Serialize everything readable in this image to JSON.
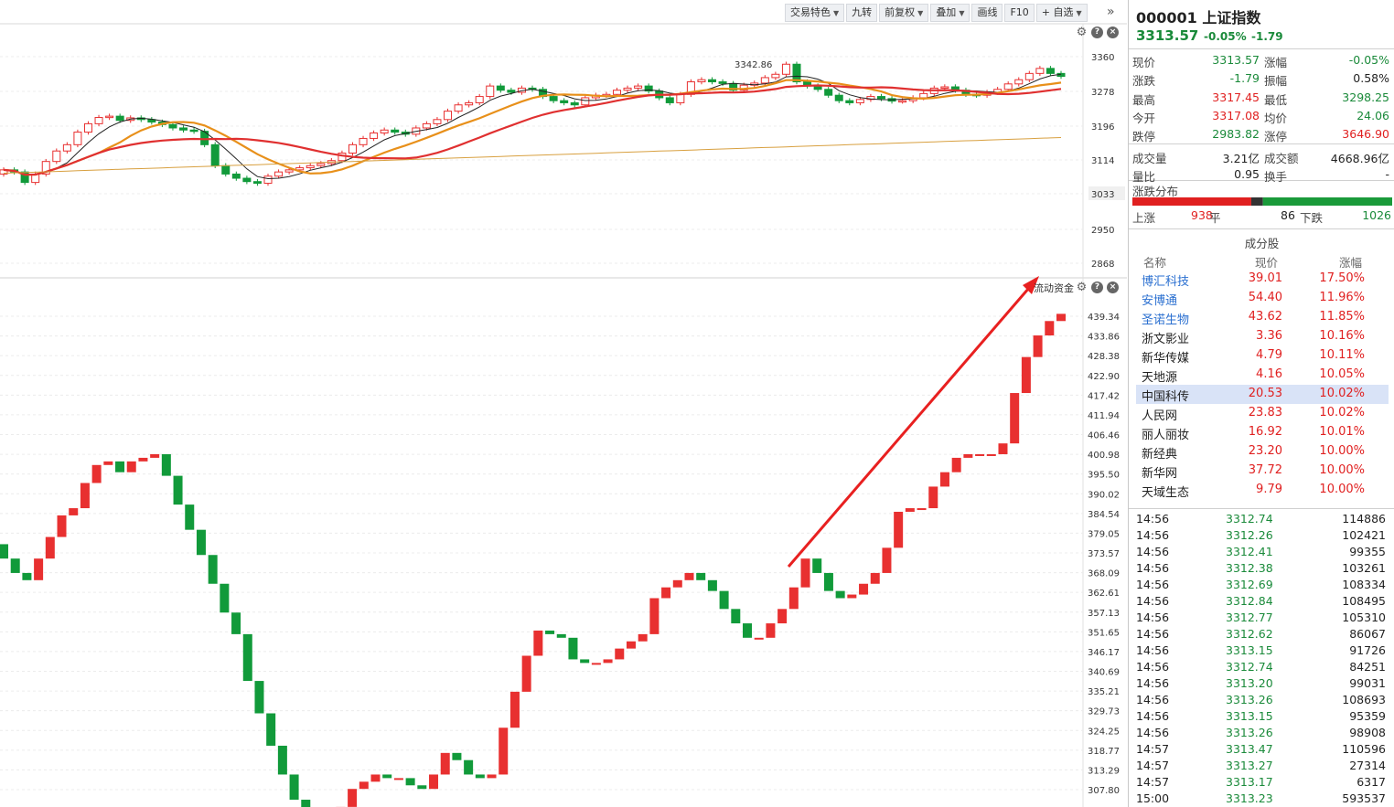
{
  "toolbar": {
    "buttons": [
      {
        "label": "交易特色",
        "dropdown": true
      },
      {
        "label": "九转",
        "dropdown": false
      },
      {
        "label": "前复权",
        "dropdown": true
      },
      {
        "label": "叠加",
        "dropdown": true
      },
      {
        "label": "画线",
        "dropdown": false
      },
      {
        "label": "F10",
        "dropdown": false
      },
      {
        "label": "+ 自选",
        "dropdown": true
      }
    ],
    "more_icon": "double-chevron-right-icon"
  },
  "kline": {
    "peak_label": "3342.86",
    "axis_labels": [
      "3360",
      "3278",
      "3196",
      "3114",
      "3033",
      "2950",
      "2868"
    ],
    "highlight_label": "3033"
  },
  "flow": {
    "label": "流动资金",
    "axis_labels": [
      "439.34",
      "433.86",
      "428.38",
      "422.90",
      "417.42",
      "411.94",
      "406.46",
      "400.98",
      "395.50",
      "390.02",
      "384.54",
      "379.05",
      "373.57",
      "368.09",
      "362.61",
      "357.13",
      "351.65",
      "346.17",
      "340.69",
      "335.21",
      "329.73",
      "324.25",
      "318.77",
      "313.29",
      "307.80"
    ]
  },
  "quote": {
    "code_name": "000001 上证指数",
    "price": "3313.57",
    "pct": "-0.05%",
    "chg": "-1.79",
    "rows": [
      {
        "k1": "现价",
        "v1": "3313.57",
        "c1": "green",
        "k2": "涨幅",
        "v2": "-0.05%",
        "c2": "green"
      },
      {
        "k1": "涨跌",
        "v1": "-1.79",
        "c1": "green",
        "k2": "振幅",
        "v2": "0.58%",
        "c2": "blk"
      },
      {
        "k1": "最高",
        "v1": "3317.45",
        "c1": "red",
        "k2": "最低",
        "v2": "3298.25",
        "c2": "green"
      },
      {
        "k1": "今开",
        "v1": "3317.08",
        "c1": "red",
        "k2": "均价",
        "v2": "24.06",
        "c2": "green"
      },
      {
        "k1": "跌停",
        "v1": "2983.82",
        "c1": "green",
        "k2": "涨停",
        "v2": "3646.90",
        "c2": "red"
      },
      {
        "k1": "成交量",
        "v1": "3.21亿",
        "c1": "blk",
        "k2": "成交额",
        "v2": "4668.96亿",
        "c2": "blk"
      },
      {
        "k1": "量比",
        "v1": "0.95",
        "c1": "blk",
        "k2": "换手",
        "v2": "-",
        "c2": "blk"
      }
    ]
  },
  "distribution": {
    "title": "涨跌分布",
    "up_label": "上涨",
    "up": "938",
    "flat_label": "平",
    "flat": "86",
    "down_label": "下跌",
    "down": "1026",
    "up_count": 938,
    "flat_count": 86,
    "down_count": 1026
  },
  "components": {
    "title": "成分股",
    "headers": {
      "name": "名称",
      "price": "现价",
      "change": "涨幅"
    },
    "rows": [
      {
        "name": "博汇科技",
        "price": "39.01",
        "change": "17.50%",
        "blue": true,
        "hl": false
      },
      {
        "name": "安博通",
        "price": "54.40",
        "change": "11.96%",
        "blue": true,
        "hl": false
      },
      {
        "name": "圣诺生物",
        "price": "43.62",
        "change": "11.85%",
        "blue": true,
        "hl": false
      },
      {
        "name": "浙文影业",
        "price": "3.36",
        "change": "10.16%",
        "blue": false,
        "hl": false
      },
      {
        "name": "新华传媒",
        "price": "4.79",
        "change": "10.11%",
        "blue": false,
        "hl": false
      },
      {
        "name": "天地源",
        "price": "4.16",
        "change": "10.05%",
        "blue": false,
        "hl": false
      },
      {
        "name": "中国科传",
        "price": "20.53",
        "change": "10.02%",
        "blue": false,
        "hl": true
      },
      {
        "name": "人民网",
        "price": "23.83",
        "change": "10.02%",
        "blue": false,
        "hl": false
      },
      {
        "name": "丽人丽妆",
        "price": "16.92",
        "change": "10.01%",
        "blue": false,
        "hl": false
      },
      {
        "name": "新经典",
        "price": "23.20",
        "change": "10.00%",
        "blue": false,
        "hl": false
      },
      {
        "name": "新华网",
        "price": "37.72",
        "change": "10.00%",
        "blue": false,
        "hl": false
      },
      {
        "name": "天域生态",
        "price": "9.79",
        "change": "10.00%",
        "blue": false,
        "hl": false
      }
    ]
  },
  "ticks": [
    {
      "time": "14:56",
      "price": "3312.74",
      "vol": "114886"
    },
    {
      "time": "14:56",
      "price": "3312.26",
      "vol": "102421"
    },
    {
      "time": "14:56",
      "price": "3312.41",
      "vol": "99355"
    },
    {
      "time": "14:56",
      "price": "3312.38",
      "vol": "103261"
    },
    {
      "time": "14:56",
      "price": "3312.69",
      "vol": "108334"
    },
    {
      "time": "14:56",
      "price": "3312.84",
      "vol": "108495"
    },
    {
      "time": "14:56",
      "price": "3312.77",
      "vol": "105310"
    },
    {
      "time": "14:56",
      "price": "3312.62",
      "vol": "86067"
    },
    {
      "time": "14:56",
      "price": "3313.15",
      "vol": "91726"
    },
    {
      "time": "14:56",
      "price": "3312.74",
      "vol": "84251"
    },
    {
      "time": "14:56",
      "price": "3313.20",
      "vol": "99031"
    },
    {
      "time": "14:56",
      "price": "3313.26",
      "vol": "108693"
    },
    {
      "time": "14:56",
      "price": "3313.15",
      "vol": "95359"
    },
    {
      "time": "14:56",
      "price": "3313.26",
      "vol": "98908"
    },
    {
      "time": "14:57",
      "price": "3313.47",
      "vol": "110596"
    },
    {
      "time": "14:57",
      "price": "3313.27",
      "vol": "27314"
    },
    {
      "time": "14:57",
      "price": "3313.17",
      "vol": "6317"
    },
    {
      "time": "15:00",
      "price": "3313.23",
      "vol": "593537"
    }
  ],
  "colors": {
    "up": "#e83030",
    "down": "#119a3a",
    "ma5": "#222222",
    "ma10": "#e8901a",
    "ma20": "#e03030",
    "ma60": "#d8a040"
  }
}
